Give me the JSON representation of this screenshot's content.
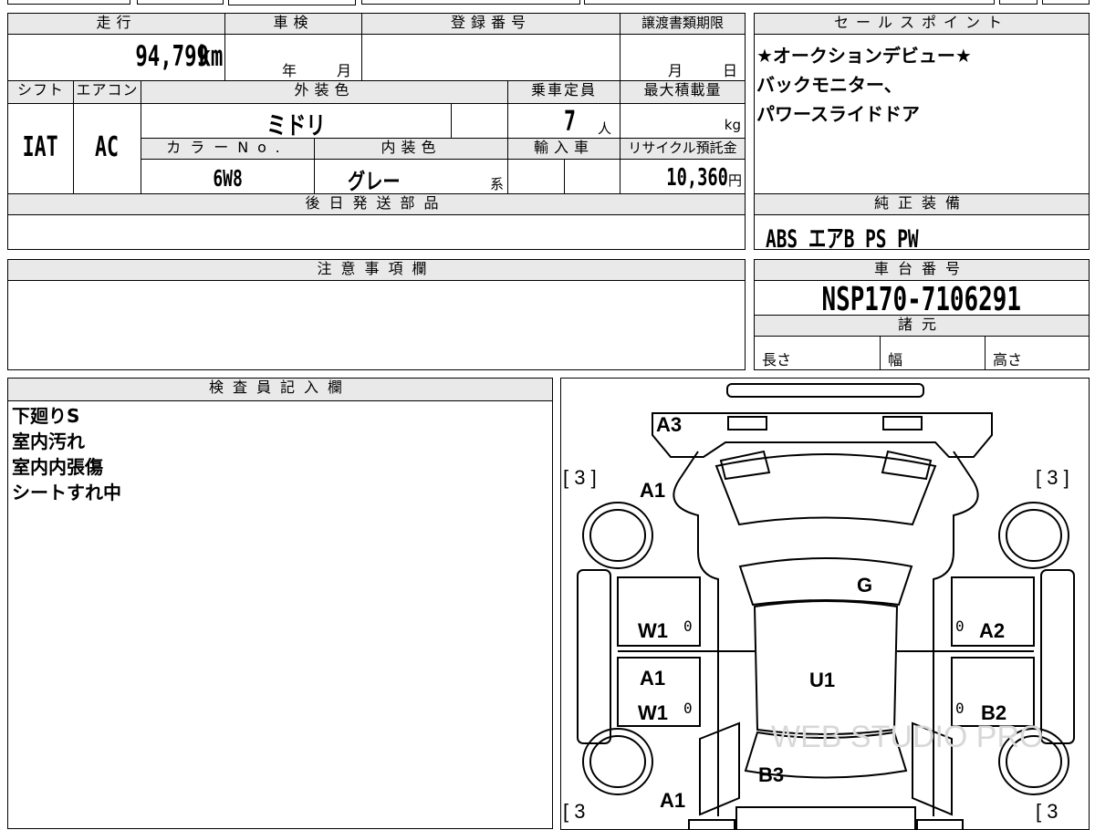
{
  "row1": {
    "mileage_header": "走行",
    "inspection_header": "車検",
    "registration_header": "登録番号",
    "transfer_deadline_header": "譲渡書類期限",
    "selling_points_header": "セールスポイント",
    "mileage_value": "94,799",
    "mileage_unit": "km",
    "inspection_year": "年",
    "inspection_month": "月",
    "transfer_month": "月",
    "transfer_day": "日"
  },
  "selling_points": [
    "★オークションデビュー★",
    "バックモニター、",
    "パワースライドドア"
  ],
  "row2": {
    "shift_header": "シフト",
    "ac_header": "エアコン",
    "exterior_color_header": "外装色",
    "capacity_header": "乗車定員",
    "max_load_header": "最大積載量",
    "shift_value": "IAT",
    "ac_value": "AC",
    "exterior_color_value": "ミドリ",
    "capacity_value": "7",
    "capacity_unit": "人",
    "max_load_unit": "kg"
  },
  "row3": {
    "color_no_header": "カラーNo.",
    "interior_color_header": "内装色",
    "import_header": "輸入車",
    "recycle_header": "リサイクル預託金",
    "color_no_value": "6W8",
    "interior_color_value": "グレー",
    "interior_suffix": "系",
    "recycle_value": "10,360",
    "recycle_unit": "円"
  },
  "later_parts_header": "後日発送部品",
  "genuine_equipment_header": "純正装備",
  "genuine_equipment_value": "ABS エアB PS PW",
  "notes_header": "注意事項欄",
  "chassis_header": "車台番号",
  "chassis_value": "NSP170-7106291",
  "specs_header": "諸元",
  "specs": {
    "length": "長さ",
    "width": "幅",
    "height": "高さ"
  },
  "inspector_header": "検査員記入欄",
  "inspector_notes": [
    "下廻りS",
    "室内汚れ",
    "室内内張傷",
    "シートすれ中"
  ],
  "car_diagram": {
    "marks": {
      "front_bumper": "A3",
      "front_left_fender": "A1",
      "hood": "G",
      "front_left_door": "W1",
      "front_left_door_zero": "0",
      "front_right_door_zero": "0",
      "front_right_door": "A2",
      "rear_left_door_a": "A1",
      "rear_left_door_w": "W1",
      "rear_left_door_zero": "0",
      "roof": "U1",
      "rear_right_door_zero": "0",
      "rear_right_door": "B2",
      "trunk": "B3",
      "rear_left_fender": "A1"
    },
    "tire_tl": "[ 3 ]",
    "tire_tr": "[ 3 ]",
    "tire_bl": "[ 3",
    "tire_br": "[ 3",
    "watermark": "WEB STUDIO PRO"
  }
}
